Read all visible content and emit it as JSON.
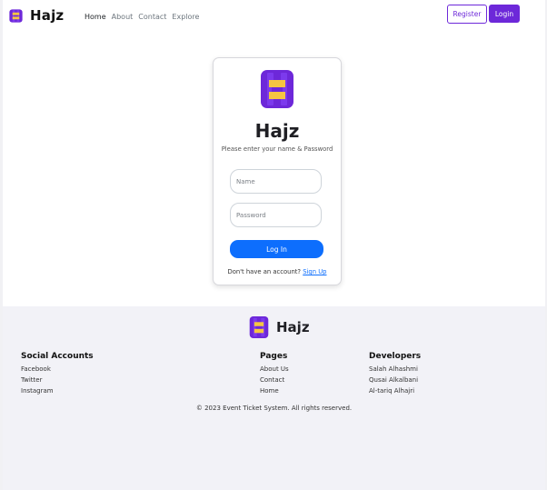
{
  "brand": {
    "name": "Hajz",
    "logo_icon": "h-logo-icon",
    "colors": {
      "purple": "#6d28d9",
      "yellow": "#f5c542"
    }
  },
  "nav": {
    "links": [
      "Home",
      "About",
      "Contact",
      "Explore"
    ],
    "active": "Home",
    "register_label": "Register",
    "login_label": "Login"
  },
  "login_card": {
    "title": "Hajz",
    "subtitle": "Please enter your name & Password",
    "name_placeholder": "Name",
    "password_placeholder": "Password",
    "submit_label": "Log In",
    "signup_prompt": "Don't have an account?",
    "signup_link": "Sign Up"
  },
  "footer": {
    "brand": "Hajz",
    "social": {
      "heading": "Social Accounts",
      "items": [
        "Facebook",
        "Twitter",
        "Instagram"
      ]
    },
    "pages": {
      "heading": "Pages",
      "items": [
        "About Us",
        "Contact",
        "Home"
      ]
    },
    "developers": {
      "heading": "Developers",
      "items": [
        "Salah Alhashmi",
        "Qusai Alkalbani",
        "Al-tariq Alhajri"
      ]
    },
    "copyright": "© 2023 Event Ticket System. All rights reserved."
  },
  "accent_colors": {
    "primary_button": "#0d6efd",
    "brand_purple": "#6d28d9"
  }
}
